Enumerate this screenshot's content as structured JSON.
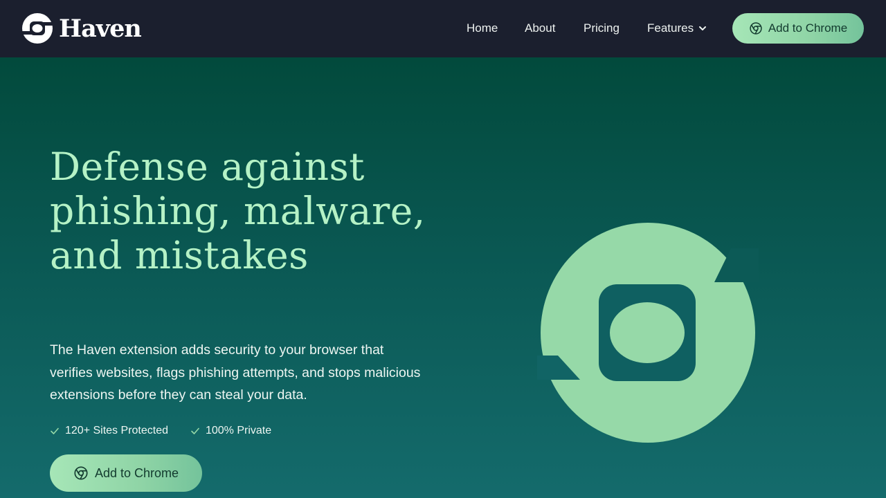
{
  "brand": {
    "name": "Haven",
    "logo_icon": "haven-logo-icon"
  },
  "nav": {
    "links": [
      "Home",
      "About",
      "Pricing"
    ],
    "features_label": "Features",
    "cta_label": "Add to Chrome",
    "cta_icon": "chrome-icon"
  },
  "hero": {
    "title": "Defense against phishing, malware, and mistakes",
    "description": "The Haven extension adds security to your browser that verifies websites, flags phishing attempts, and stops malicious extensions before they can steal your data.",
    "features": [
      "120+ Sites Protected",
      "100% Private"
    ],
    "cta_label": "Add to Chrome",
    "illustration_icon": "haven-logo-icon"
  },
  "colors": {
    "nav_background": "#1b1f2e",
    "hero_gradient_top": "#024a3c",
    "hero_gradient_bottom": "#146b6c",
    "accent_green": "#96d9a8",
    "title_green": "#b5f2c6",
    "button_text": "#123a2e"
  }
}
